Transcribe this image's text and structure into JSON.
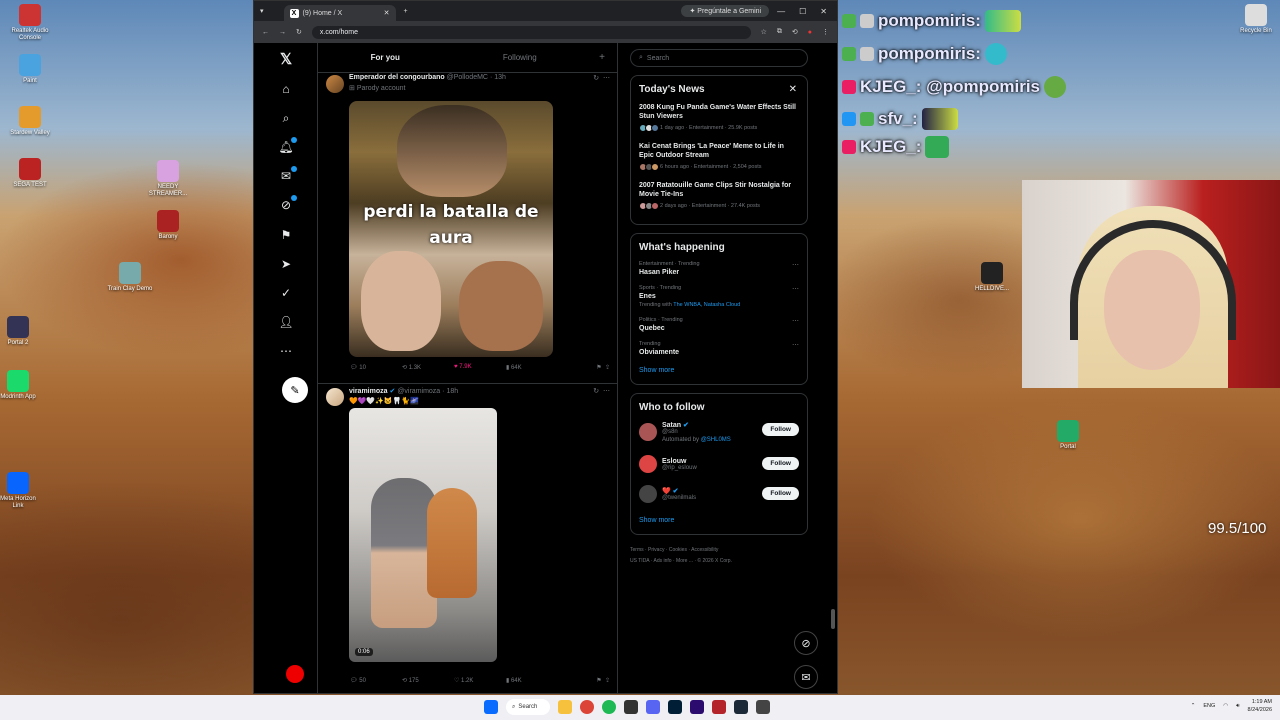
{
  "browser": {
    "tab_title": "(9) Home / X",
    "gemini_label": "Pregúntale a Gemini",
    "url": "x.com/home"
  },
  "desktop_icons": [
    {
      "label": "Realtek Audio Console",
      "color": "#c33"
    },
    {
      "label": "Paint",
      "color": "#4aa3df"
    },
    {
      "label": "Stardew Valley",
      "color": "#e59b2c"
    },
    {
      "label": "SEGA TEST",
      "color": "#b22"
    },
    {
      "label": "NEEDY STREAMER...",
      "color": "#d8a1e0"
    },
    {
      "label": "Barony",
      "color": "#a22"
    },
    {
      "label": "Train Clay Demo",
      "color": "#7aa"
    },
    {
      "label": "Portal 2",
      "color": "#335"
    },
    {
      "label": "Modrinth App",
      "color": "#1bd96a"
    },
    {
      "label": "Meta Horizon Link",
      "color": "#0866ff"
    },
    {
      "label": "Recycle Bin",
      "color": "#ddd"
    },
    {
      "label": "HELLDIVE...",
      "color": "#222"
    },
    {
      "label": "Portal",
      "color": "#2a6"
    }
  ],
  "nav": {
    "items": [
      "x-logo",
      "home-icon",
      "search-icon",
      "notifications-icon",
      "messages-icon",
      "grok-icon",
      "bookmarks-icon",
      "premium-icon",
      "verified-icon",
      "profile-icon",
      "more-icon"
    ]
  },
  "feed": {
    "tabs": [
      "For you",
      "Following"
    ],
    "tweets": [
      {
        "name": "Emperador del congourbano",
        "handle": "@PollodeMC",
        "time": "13h",
        "subtitle": "Parody account",
        "meme_text": "perdi la batalla de aura",
        "replies": "10",
        "reposts": "1.3K",
        "likes": "7.9K",
        "views": "64K"
      },
      {
        "name": "viramimoza",
        "handle": "@viramimoza",
        "time": "18h",
        "emoji_line": "🧡💜🤍✨🐱🦷🐈🌌",
        "duration": "0:06",
        "replies": "50",
        "reposts": "175",
        "likes": "1.2K",
        "views": "64K"
      }
    ]
  },
  "sidebar": {
    "search_placeholder": "Search",
    "news_title": "Today's News",
    "news": [
      {
        "title": "2008 Kung Fu Panda Game's Water Effects Still Stun Viewers",
        "meta": "1 day ago · Entertainment · 25.9K posts"
      },
      {
        "title": "Kai Cenat Brings 'La Peace' Meme to Life in Epic Outdoor Stream",
        "meta": "6 hours ago · Entertainment · 2,504 posts"
      },
      {
        "title": "2007 Ratatouille Game Clips Stir Nostalgia for Movie Tie-Ins",
        "meta": "2 days ago · Entertainment · 27.4K posts"
      }
    ],
    "happening_title": "What's happening",
    "trends": [
      {
        "context": "Entertainment · Trending",
        "name": "Hasan Piker",
        "extra": ""
      },
      {
        "context": "Sports · Trending",
        "name": "Enes",
        "extra_prefix": "Trending with",
        "extra": "The WNBA, Natasha Cloud"
      },
      {
        "context": "Politics · Trending",
        "name": "Quebec",
        "extra": ""
      },
      {
        "context": "Trending",
        "name": "Obviamente",
        "extra": ""
      }
    ],
    "show_more": "Show more",
    "who_title": "Who to follow",
    "who": [
      {
        "name": "Satan",
        "handle": "@s8n",
        "auto_prefix": "Automated by",
        "auto": "@SHL0MS",
        "color": "#a55"
      },
      {
        "name": "Eslouw",
        "handle": "@rip_eslouw",
        "color": "#d44"
      },
      {
        "name": "❤️",
        "handle": "@twenilmals",
        "color": "#444"
      }
    ],
    "follow_label": "Follow",
    "footer_line1": "Terms  ·  Privacy  ·  Cookies  ·  Accessibility",
    "footer_line2": "US TIDA  ·  Ads info  ·  More ...  ·  © 2026 X Corp."
  },
  "stream": {
    "chat": [
      {
        "name": "pompomiris:",
        "color": "#4caf50"
      },
      {
        "name": "pompomiris:",
        "color": "#4caf50"
      },
      {
        "name": "KJEG_: @pompomiris",
        "color": "#e91e63"
      },
      {
        "name": "sfv_:",
        "color": "#2196f3"
      },
      {
        "name": "KJEG_:",
        "color": "#e91e63"
      }
    ],
    "score": "99.5/100"
  },
  "taskbar": {
    "search_label": "Search",
    "lang": "ENG",
    "time": "1:19 AM",
    "date": "8/24/2026"
  }
}
